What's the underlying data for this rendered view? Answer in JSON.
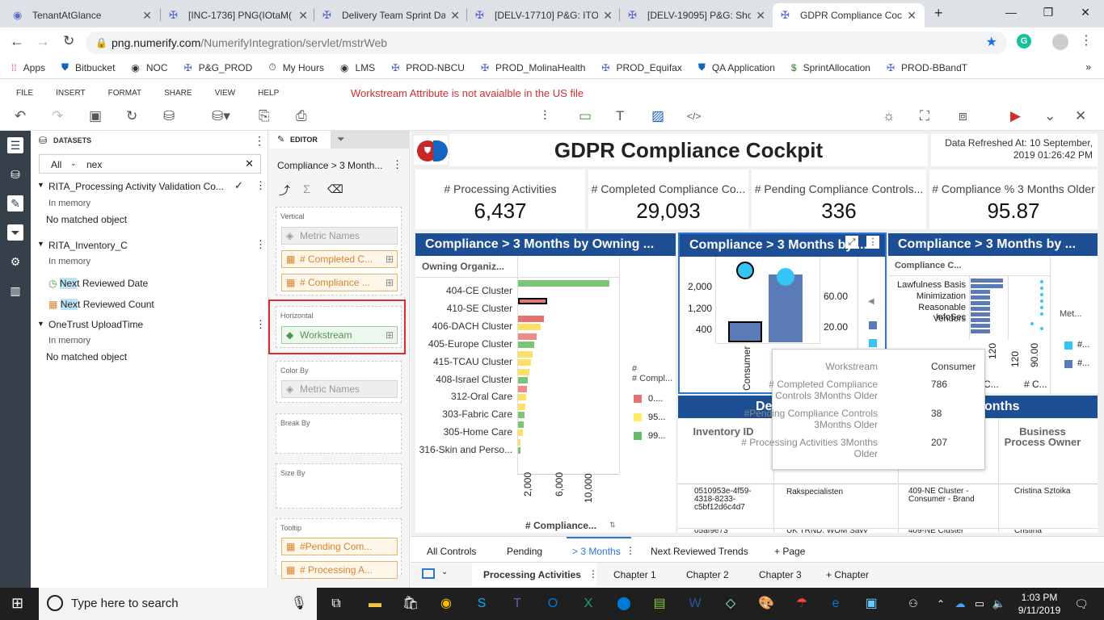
{
  "browser": {
    "tabs": [
      {
        "title": "TenantAtGlance"
      },
      {
        "title": "[INC-1736] PNG(IOtaM("
      },
      {
        "title": "Delivery Team Sprint Da"
      },
      {
        "title": "[DELV-17710] P&G: ITO"
      },
      {
        "title": "[DELV-19095] P&G: Sho"
      },
      {
        "title": "GDPR Compliance Cock"
      }
    ],
    "url_host": "png.numerify.com",
    "url_path": "/NumerifyIntegration/servlet/mstrWeb",
    "bookmarks": [
      "Apps",
      "Bitbucket",
      "NOC",
      "P&G_PROD",
      "My Hours",
      "LMS",
      "PROD-NBCU",
      "PROD_MolinaHealth",
      "PROD_Equifax",
      "QA Application",
      "SprintAllocation",
      "PROD-BBandT"
    ]
  },
  "app": {
    "menu": [
      "FILE",
      "INSERT",
      "FORMAT",
      "SHARE",
      "VIEW",
      "HELP"
    ],
    "warning": "Workstream Attribute is not avaialble in the US file"
  },
  "datasets": {
    "header": "DATASETS",
    "filter": "All",
    "search_value": "nex",
    "groups": [
      {
        "name": "RITA_Processing Activity Validation Co...",
        "status": "In memory",
        "items": [],
        "empty": "No matched object"
      },
      {
        "name": "RITA_Inventory_C",
        "status": "In memory",
        "items": [
          {
            "highlight": "Nex",
            "rest": "t Reviewed Date"
          },
          {
            "highlight": "Nex",
            "rest": "t Reviewed Count"
          }
        ]
      },
      {
        "name": "OneTrust UploadTime",
        "status": "In memory",
        "items": [],
        "empty": "No matched object"
      }
    ]
  },
  "editor": {
    "tab": "EDITOR",
    "title": "Compliance > 3 Month...",
    "vertical_label": "Vertical",
    "vertical": [
      "Metric Names",
      "# Completed C...",
      "# Compliance ..."
    ],
    "horizontal_label": "Horizontal",
    "horizontal": [
      "Workstream"
    ],
    "colorby_label": "Color By",
    "colorby": [
      "Metric Names"
    ],
    "breakby_label": "Break By",
    "sizeby_label": "Size By",
    "tooltip_label": "Tooltip",
    "tooltip": [
      "#Pending Com...",
      "# Processing A..."
    ]
  },
  "dashboard": {
    "title": "GDPR Compliance Cockpit",
    "refreshed": "Data Refreshed At: 10 September, 2019 01:26:42 PM",
    "kpis": [
      {
        "label": "# Processing Activities",
        "value": "6,437"
      },
      {
        "label": "# Completed Compliance Co...",
        "value": "29,093"
      },
      {
        "label": "# Pending Compliance Controls...",
        "value": "336"
      },
      {
        "label": "# Compliance % 3 Months Older",
        "value": "95.87"
      }
    ],
    "panel1": {
      "title": "Compliance > 3 Months by Owning ...",
      "col_header": "Owning Organiz...",
      "rows": [
        "404-CE Cluster",
        "410-SE Cluster",
        "406-DACH Cluster",
        "405-Europe Cluster",
        "415-TCAU Cluster",
        "408-Israel Cluster",
        "312-Oral Care",
        "303-Fabric Care",
        "305-Home Care",
        "316-Skin and Perso..."
      ],
      "axis_ticks": [
        "2,000",
        "6,000",
        "10,000"
      ],
      "axis_label": "# Compliance...",
      "legend_title": "# Compl...",
      "legend": [
        "0....",
        "95...",
        "99..."
      ]
    },
    "panel2": {
      "title": "Compliance > 3 Months by ...",
      "left_ticks": [
        "2,000",
        "1,200",
        "400"
      ],
      "right_ticks": [
        "60.00",
        "20.00"
      ],
      "x_label": "Consumer"
    },
    "panel3": {
      "title": "Compliance > 3 Months by ...",
      "col_header": "Compliance C...",
      "rows": [
        "Lawfulness Basis",
        "Minimization",
        "Reasonable InfoSec",
        "Vendors"
      ],
      "ticks": [
        "120",
        "90.00"
      ],
      "legend_title": "Met...",
      "legend": [
        "#...",
        "#..."
      ],
      "footer": [
        "C...",
        "# C..."
      ]
    },
    "table": {
      "title_left": "De",
      "title_right": "onths",
      "headers": [
        "Inventory ID",
        "",
        "",
        "Business Process Owner"
      ],
      "rows": [
        [
          "0510953e-4f59-4318-8233-c5bf12d6c4d7",
          "Rakspecialisten",
          "409-NE Cluster - Consumer - Brand",
          "Cristina Sztoika"
        ],
        [
          "05af9e73",
          "UK TRND, WOM Sayv",
          "409-NE Cluster",
          "Cristina"
        ]
      ]
    },
    "tooltip": {
      "rows": [
        {
          "k": "Workstream",
          "v": "Consumer"
        },
        {
          "k": "# Completed Compliance Controls 3Months Older",
          "v": "786"
        },
        {
          "k": "#Pending Compliance Controls 3Months Older",
          "v": "38"
        },
        {
          "k": "# Processing Activities 3Months Older",
          "v": "207"
        }
      ]
    }
  },
  "pages": [
    "All Controls",
    "Pending",
    "> 3 Months",
    "Next Reviewed Trends",
    "+ Page"
  ],
  "chapters": [
    "Processing Activities",
    "Chapter 1",
    "Chapter 2",
    "Chapter 3",
    "+ Chapter"
  ],
  "taskbar": {
    "search": "Type here to search",
    "time": "1:03 PM",
    "date": "9/11/2019"
  }
}
